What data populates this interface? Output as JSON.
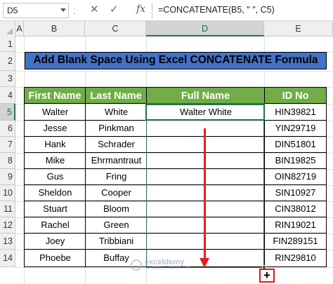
{
  "formula_bar": {
    "name_box": "D5",
    "separator": ":",
    "cancel_glyph": "✕",
    "enter_glyph": "✓",
    "fx_label": "fx",
    "formula": "=CONCATENATE(B5, \" \", C5)"
  },
  "columns": [
    "A",
    "B",
    "C",
    "D",
    "E"
  ],
  "rows": [
    "1",
    "2",
    "3",
    "4",
    "5",
    "6",
    "7",
    "8",
    "9",
    "10",
    "11",
    "12",
    "13",
    "14"
  ],
  "selected": {
    "column": "D",
    "row": "5"
  },
  "title": "Add Blank Space Using Excel CONCATENATE Formula",
  "table": {
    "headers": [
      "First Name",
      "Last Name",
      "Full Name",
      "ID No"
    ],
    "rows": [
      [
        "Walter",
        "White",
        "Walter White",
        "HIN39821"
      ],
      [
        "Jesse",
        "Pinkman",
        "",
        "YIN29719"
      ],
      [
        "Hank",
        "Schrader",
        "",
        "DIN51801"
      ],
      [
        "Mike",
        "Ehrmantraut",
        "",
        "BIN19825"
      ],
      [
        "Gus",
        "Fring",
        "",
        "OIN82719"
      ],
      [
        "Sheldon",
        "Cooper",
        "",
        "SIN10927"
      ],
      [
        "Stuart",
        "Bloom",
        "",
        "CIN38012"
      ],
      [
        "Rachel",
        "Green",
        "",
        "RIN19021"
      ],
      [
        "Joey",
        "Tribbiani",
        "",
        "FIN289151"
      ],
      [
        "Phoebe",
        "Buffay",
        "",
        "RIN29810"
      ]
    ]
  },
  "fill_indicator": "+",
  "watermark": {
    "name": "exceldemy",
    "tagline": "EXCEL · DATA · BI"
  },
  "colors": {
    "title_bg": "#4472c4",
    "header_bg": "#70ad47",
    "selection": "#217346",
    "arrow": "#e02020"
  }
}
